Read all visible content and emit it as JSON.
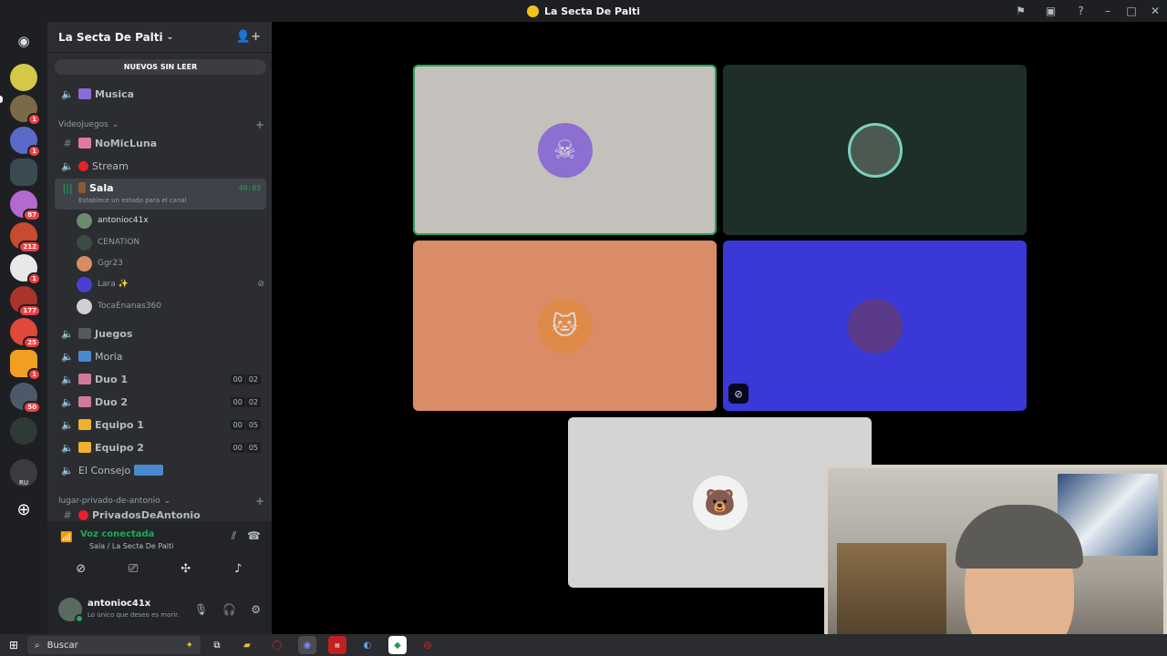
{
  "window": {
    "title": "La Secta De Palti"
  },
  "server": {
    "name": "La Secta De Palti",
    "unread_banner": "NUEVOS SIN LEER"
  },
  "guild_badges": [
    "",
    "1",
    "1",
    "",
    "87",
    "212",
    "1",
    "177",
    "25",
    "1",
    "50",
    "RU"
  ],
  "channels": {
    "musica": "Musica",
    "cat_videojuegos": "Videojuegos",
    "nomicluna": "NoMicLuna",
    "stream": "Stream",
    "sala": "Sala",
    "sala_timer": "49:03",
    "sala_status": "Establece un estado para el canal",
    "juegos": "Juegos",
    "moria": "Moria",
    "duo1": "Duo 1",
    "duo2": "Duo 2",
    "equipo1": "Equipo 1",
    "equipo2": "Equipo 2",
    "consejo": "El Consejo",
    "cat_privado": "lugar-privado-de-antonio",
    "privados": "PrivadosDeAntonio",
    "counter_00": "00",
    "counter_02": "02",
    "counter_05": "05"
  },
  "members": [
    {
      "name": "antonioc41x",
      "color": "#6d8a6e"
    },
    {
      "name": "CENATION",
      "color": "#3e4a44"
    },
    {
      "name": "Ggr23",
      "color": "#d98c5f"
    },
    {
      "name": "Lara ✨",
      "color": "#4a3fd1"
    },
    {
      "name": "TocaEnanas360",
      "color": "#cfcfcf"
    }
  ],
  "voice": {
    "status": "Voz conectada",
    "location": "Sala / La Secta De Palti"
  },
  "user": {
    "name": "antonioc41x",
    "status": "Lo único que deseo es morir."
  },
  "tiles": [
    {
      "color": "#c4c0bb",
      "avatar_color": "#8c6fd0"
    },
    {
      "color": "#1e2e28",
      "avatar_color": "#4a5a50"
    },
    {
      "color": "#d98c66",
      "avatar_color": "#e08a4a"
    },
    {
      "color": "#3a38d6",
      "avatar_color": "#5b3a8a"
    },
    {
      "color": "#d4d4d4",
      "avatar_color": "#f2f2f2"
    }
  ],
  "taskbar": {
    "search_placeholder": "Buscar"
  },
  "colors": {
    "accent_green": "#23a55a",
    "unread_red": "#f23f43"
  }
}
